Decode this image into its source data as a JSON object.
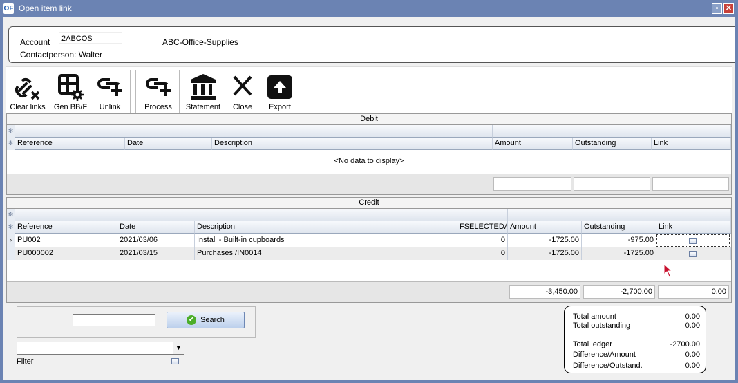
{
  "window": {
    "title": "Open item link",
    "app_icon": "OF"
  },
  "header": {
    "account_label": "Account",
    "account_value": "2ABCOS",
    "company_name": "ABC-Office-Supplies",
    "contact_label": "Contactperson: Walter"
  },
  "toolbar": [
    {
      "label": "Clear links",
      "icon": "unlink-chain-x-icon"
    },
    {
      "label": "Gen BB/F",
      "icon": "table-gear-icon"
    },
    {
      "label": "Unlink",
      "icon": "link-plus-icon"
    },
    {
      "label": "Process",
      "icon": "link-plus-icon"
    },
    {
      "label": "Statement",
      "icon": "bank-icon"
    },
    {
      "label": "Close",
      "icon": "close-x-icon"
    },
    {
      "label": "Export",
      "icon": "export-box-icon"
    }
  ],
  "debit": {
    "title": "Debit",
    "columns": [
      "Reference",
      "Date",
      "Description",
      "Amount",
      "Outstanding",
      "Link"
    ],
    "empty_text": "<No data to display>"
  },
  "credit": {
    "title": "Credit",
    "columns": [
      "Reference",
      "Date",
      "Description",
      "FSELECTEDA",
      "Amount",
      "Outstanding",
      "Link"
    ],
    "rows": [
      {
        "reference": "PU002",
        "date": "2021/03/06",
        "description": "Install - Built-in cupboards",
        "fselected": "0",
        "amount": "-1725.00",
        "outstanding": "-975.00"
      },
      {
        "reference": "PU000002",
        "date": "2021/03/15",
        "description": "Purchases /IN0014",
        "fselected": "0",
        "amount": "-1725.00",
        "outstanding": "-1725.00"
      }
    ],
    "totals": {
      "amount": "-3,450.00",
      "outstanding": "-2,700.00",
      "link": "0.00"
    }
  },
  "search": {
    "button_label": "Search",
    "filter_label": "Filter"
  },
  "summary": [
    {
      "label": "Total amount",
      "value": "0.00"
    },
    {
      "label": "Total outstanding",
      "value": "0.00"
    },
    {
      "label": "Total ledger",
      "value": "-2700.00"
    },
    {
      "label": "Difference/Amount",
      "value": "0.00"
    },
    {
      "label": "Difference/Outstand.",
      "value": "0.00"
    }
  ],
  "colors": {
    "titlebar": "#6b83b3",
    "close": "#c8413a",
    "ok_green": "#4cae2a"
  }
}
